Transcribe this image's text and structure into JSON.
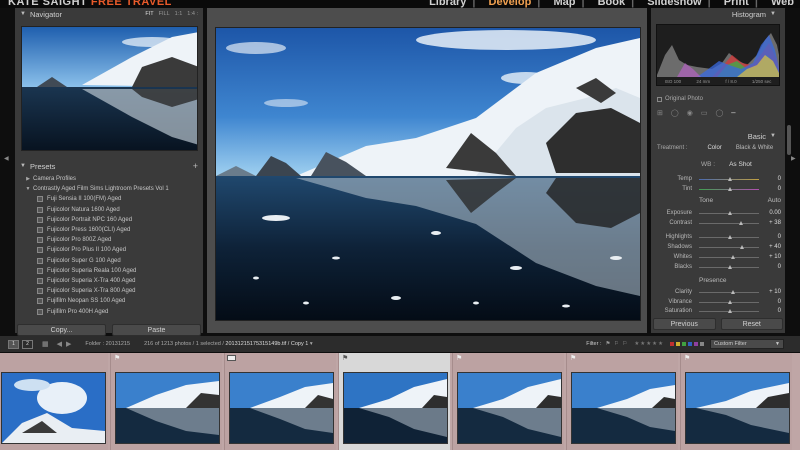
{
  "app": {
    "brand_main": "KATE SAIGHT",
    "brand_accent": "FREE TRAVEL",
    "modules": [
      "Library",
      "Develop",
      "Map",
      "Book",
      "Slideshow",
      "Print",
      "Web"
    ],
    "active_module": "Develop"
  },
  "navigator": {
    "title": "Navigator",
    "zoom_levels": [
      "FIT",
      "FILL",
      "1:1",
      "1:4 :"
    ]
  },
  "presets": {
    "title": "Presets",
    "items": [
      {
        "label": "Camera Profiles",
        "type": "group"
      },
      {
        "label": "Contrastly Aged Film Sims Lightroom Presets Vol 1",
        "type": "group"
      },
      {
        "label": "Fuji Sensia II 100(FM) Aged",
        "type": "preset"
      },
      {
        "label": "Fujicolor Natura 1600 Aged",
        "type": "preset"
      },
      {
        "label": "Fujicolor Portrait NPC 160 Aged",
        "type": "preset"
      },
      {
        "label": "Fujicolor Press 1600(CLI) Aged",
        "type": "preset"
      },
      {
        "label": "Fujicolor Pro 800Z Aged",
        "type": "preset"
      },
      {
        "label": "Fujicolor Pro Plus II 100 Aged",
        "type": "preset"
      },
      {
        "label": "Fujicolor Super G 100 Aged",
        "type": "preset"
      },
      {
        "label": "Fujicolor Superia Reala 100 Aged",
        "type": "preset"
      },
      {
        "label": "Fujicolor Superia X-Tra 400 Aged",
        "type": "preset"
      },
      {
        "label": "Fujicolor Superia X-Tra 800 Aged",
        "type": "preset"
      },
      {
        "label": "Fujifilm Neopan SS 100 Aged",
        "type": "preset"
      },
      {
        "label": "Fujifilm Pro 400H Aged",
        "type": "preset"
      }
    ],
    "copy_label": "Copy...",
    "paste_label": "Paste"
  },
  "histogram": {
    "title": "Histogram",
    "iso": "ISO 100",
    "focal": "24 mm",
    "aperture": "f / 8.0",
    "shutter": "1/250 sec",
    "original_photo_label": "Original Photo"
  },
  "basic": {
    "title": "Basic",
    "treatment_label": "Treatment :",
    "color_label": "Color",
    "bw_label": "Black & White",
    "wb_label": "WB :",
    "wb_value": "As Shot",
    "temp": {
      "label": "Temp",
      "value": "0"
    },
    "tint": {
      "label": "Tint",
      "value": "0"
    },
    "tone_label": "Tone",
    "auto_label": "Auto",
    "exposure": {
      "label": "Exposure",
      "value": "0.00"
    },
    "contrast": {
      "label": "Contrast",
      "value": "+ 38"
    },
    "highlights": {
      "label": "Highlights",
      "value": "0"
    },
    "shadows": {
      "label": "Shadows",
      "value": "+ 40"
    },
    "whites": {
      "label": "Whites",
      "value": "+ 10"
    },
    "blacks": {
      "label": "Blacks",
      "value": "0"
    },
    "presence_label": "Presence",
    "clarity": {
      "label": "Clarity",
      "value": "+ 10"
    },
    "vibrance": {
      "label": "Vibrance",
      "value": "0"
    },
    "saturation": {
      "label": "Saturation",
      "value": "0"
    },
    "previous_label": "Previous",
    "reset_label": "Reset"
  },
  "filmstrip": {
    "page1": "1",
    "page2": "2",
    "folder": "Folder : 20131215",
    "count": "216 of 1213 photos / 1 selected /",
    "filename": "20131215175315149b.tif / Copy 1",
    "filter_label": "Filter :",
    "custom_filter": "Custom Filter"
  },
  "colors": {
    "accent": "#e85a2a",
    "active_module": "#f0a050",
    "panel_bg": "#3a3a3a",
    "center_bg": "#4d4d4d",
    "strip_bg": "#bfa6a6"
  }
}
